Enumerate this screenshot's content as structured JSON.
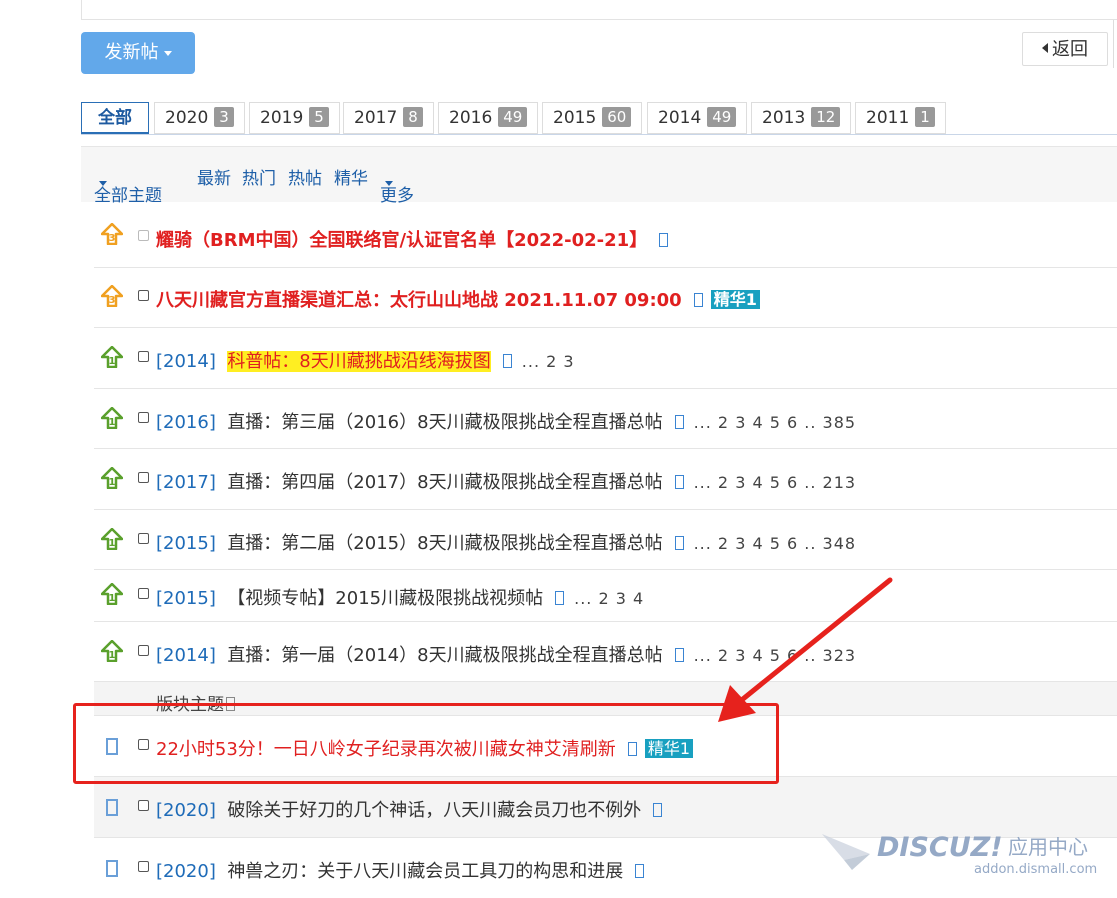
{
  "toolbar": {
    "new_post_label": "发新帖",
    "back_label": "返回"
  },
  "year_tabs": [
    {
      "label": "全部",
      "count": ""
    },
    {
      "label": "2020",
      "count": "3"
    },
    {
      "label": "2019",
      "count": "5"
    },
    {
      "label": "2017",
      "count": "8"
    },
    {
      "label": "2016",
      "count": "49"
    },
    {
      "label": "2015",
      "count": "60"
    },
    {
      "label": "2014",
      "count": "49"
    },
    {
      "label": "2013",
      "count": "12"
    },
    {
      "label": "2011",
      "count": "1"
    }
  ],
  "filters": {
    "all_topics": "全部主题",
    "latest": "最新",
    "hot": "热门",
    "hot_posts": "热帖",
    "digest": "精华",
    "more": "更多"
  },
  "threads": [
    {
      "tag": "",
      "title": "耀骑（BRM中国）全国联络官/认证官名单【2022-02-21】",
      "badge": "",
      "pages": "",
      "icon": "pin-3-icon"
    },
    {
      "tag": "",
      "title": "八天川藏官方直播渠道汇总：太行山山地战 2021.11.07 09:00",
      "badge": "精华1",
      "pages": "",
      "icon": "pin-3-icon"
    },
    {
      "tag": "[2014]",
      "title": "科普帖：8天川藏挑战沿线海拔图",
      "badge": "",
      "pages": "... 2 3",
      "icon": "pin-1-icon"
    },
    {
      "tag": "[2016]",
      "title": "直播：第三届（2016）8天川藏极限挑战全程直播总帖",
      "badge": "",
      "pages": "... 2 3 4 5 6 .. 385",
      "icon": "pin-1-icon"
    },
    {
      "tag": "[2017]",
      "title": "直播：第四届（2017）8天川藏极限挑战全程直播总帖",
      "badge": "",
      "pages": "... 2 3 4 5 6 .. 213",
      "icon": "pin-1-icon"
    },
    {
      "tag": "[2015]",
      "title": "直播：第二届（2015）8天川藏极限挑战全程直播总帖",
      "badge": "",
      "pages": "... 2 3 4 5 6 .. 348",
      "icon": "pin-1-icon"
    },
    {
      "tag": "[2015]",
      "title": "【视频专帖】2015川藏极限挑战视频帖",
      "badge": "",
      "pages": "... 2 3 4",
      "icon": "pin-1-icon"
    },
    {
      "tag": "[2014]",
      "title": "直播：第一届（2014）8天川藏极限挑战全程直播总帖",
      "badge": "",
      "pages": "... 2 3 4 5 6 .. 323",
      "icon": "pin-1-icon"
    }
  ],
  "section_label": "版块主题",
  "normal_threads": [
    {
      "tag": "",
      "title": "22小时53分！一日八岭女子纪录再次被川藏女神艾清刷新",
      "badge": "精华1"
    },
    {
      "tag": "[2020]",
      "title": "破除关于好刀的几个神话，八天川藏会员刀也不例外",
      "badge": ""
    },
    {
      "tag": "[2020]",
      "title": "神兽之刃：关于八天川藏会员工具刀的构思和进展",
      "badge": ""
    }
  ],
  "watermark": {
    "brand": "DISCUZ!",
    "cn": "应用中心",
    "url": "addon.dismall.com"
  },
  "colors": {
    "accent": "#62a8ea",
    "link": "#1e6bb8",
    "red": "#e02020",
    "digest": "#18a0c0",
    "highlight_box": "#e6221d"
  }
}
